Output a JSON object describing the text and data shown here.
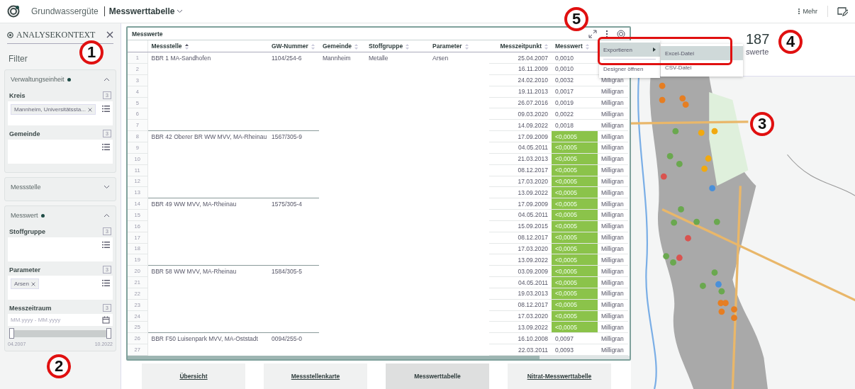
{
  "header": {
    "app_name": "Grundwassergüte",
    "view_title": "Messwerttabelle",
    "more_label": "Mehr"
  },
  "sidebar": {
    "title": "ANALYSEKONTEXT",
    "filter_heading": "Filter",
    "sections": [
      {
        "title": "Verwaltungseinheit",
        "active": true,
        "expanded": true,
        "fields": [
          {
            "kind": "chips",
            "label": "Kreis",
            "count": "3",
            "chips": [
              "Mannheim, Universitätssta..."
            ]
          },
          {
            "kind": "chips",
            "label": "Gemeinde",
            "count": "3"
          }
        ]
      },
      {
        "title": "Messstelle",
        "active": false,
        "expanded": false
      },
      {
        "title": "Messwert",
        "active": true,
        "expanded": true,
        "fields": [
          {
            "kind": "chips",
            "label": "Stoffgruppe",
            "count": "3"
          },
          {
            "kind": "chips",
            "label": "Parameter",
            "count": "3",
            "chips": [
              "Arsen"
            ]
          },
          {
            "kind": "daterange",
            "label": "Messzeitraum",
            "count": "3",
            "placeholder": "MM.yyyy - MM.yyyy",
            "range_start": "04.2007",
            "range_end": "10.2022",
            "level": 1
          }
        ]
      }
    ]
  },
  "table": {
    "title": "Messwerte",
    "columns": [
      {
        "label": "Messstelle",
        "sorted": true
      },
      {
        "label": "GW-Nummer",
        "sorted": false
      },
      {
        "label": "Gemeinde",
        "sorted": false
      },
      {
        "label": "Stoffgruppe",
        "sorted": false
      },
      {
        "label": "Parameter",
        "sorted": false
      },
      {
        "label": "Messzeitpunkt",
        "sorted": false
      },
      {
        "label": "Messwert",
        "sorted": false
      }
    ],
    "groups": [
      {
        "messstelle": "BBR 1 MA-Sandhofen",
        "gw_nummer": "1104/254-6",
        "gemeinde": "Mannheim",
        "stoffgruppe": "Metalle",
        "parameter": "Arsen",
        "rows": [
          {
            "nr": "1",
            "date": "25.04.2007",
            "value": "0,0010",
            "highlighted": false
          },
          {
            "nr": "2",
            "date": "16.11.2009",
            "value": "0,0010",
            "highlighted": false
          },
          {
            "nr": "3",
            "date": "24.02.2010",
            "value": "0,0032",
            "unit": "Milligran",
            "highlighted": false
          },
          {
            "nr": "4",
            "date": "19.11.2013",
            "value": "0,0017",
            "unit": "Milligran",
            "highlighted": false
          },
          {
            "nr": "5",
            "date": "26.07.2016",
            "value": "0,0019",
            "unit": "Milligran",
            "highlighted": false
          },
          {
            "nr": "6",
            "date": "09.03.2020",
            "value": "0,0022",
            "unit": "Milligran",
            "highlighted": false
          },
          {
            "nr": "7",
            "date": "14.09.2022",
            "value": "0,0018",
            "unit": "Milligran",
            "highlighted": false
          }
        ]
      },
      {
        "messstelle": "BBR 42 Oberer BR WW MVV, MA-Rheinau",
        "gw_nummer": "1567/305-9",
        "rows": [
          {
            "nr": "8",
            "date": "17.09.2009",
            "value": "<0,0005",
            "unit": "Milligran",
            "highlighted": true
          },
          {
            "nr": "9",
            "date": "04.05.2011",
            "value": "<0,0005",
            "unit": "Milligran",
            "highlighted": true
          },
          {
            "nr": "10",
            "date": "21.03.2013",
            "value": "<0,0005",
            "unit": "Milligran",
            "highlighted": true
          },
          {
            "nr": "11",
            "date": "08.12.2017",
            "value": "<0,0005",
            "unit": "Milligran",
            "highlighted": true
          },
          {
            "nr": "12",
            "date": "17.03.2020",
            "value": "<0,0005",
            "unit": "Milligran",
            "highlighted": true
          },
          {
            "nr": "13",
            "date": "13.09.2022",
            "value": "<0,0005",
            "unit": "Milligran",
            "highlighted": true
          }
        ]
      },
      {
        "messstelle": "BBR 49 WW MVV, MA-Rheinau",
        "gw_nummer": "1575/305-4",
        "rows": [
          {
            "nr": "14",
            "date": "17.09.2009",
            "value": "<0,0005",
            "unit": "Milligran",
            "highlighted": true
          },
          {
            "nr": "15",
            "date": "04.05.2011",
            "value": "<0,0005",
            "unit": "Milligran",
            "highlighted": true
          },
          {
            "nr": "16",
            "date": "15.09.2015",
            "value": "<0,0005",
            "unit": "Milligran",
            "highlighted": true
          },
          {
            "nr": "17",
            "date": "08.12.2017",
            "value": "<0,0005",
            "unit": "Milligran",
            "highlighted": true
          },
          {
            "nr": "18",
            "date": "17.03.2020",
            "value": "<0,0005",
            "unit": "Milligran",
            "highlighted": true
          },
          {
            "nr": "19",
            "date": "13.09.2022",
            "value": "<0,0005",
            "unit": "Milligran",
            "highlighted": true
          }
        ]
      },
      {
        "messstelle": "BBR 58 WW MVV, MA-Rheinau",
        "gw_nummer": "1584/305-5",
        "rows": [
          {
            "nr": "20",
            "date": "03.09.2009",
            "value": "<0,0005",
            "unit": "Milligran",
            "highlighted": true
          },
          {
            "nr": "21",
            "date": "04.05.2011",
            "value": "<0,0005",
            "unit": "Milligran",
            "highlighted": true
          },
          {
            "nr": "22",
            "date": "19.03.2013",
            "value": "<0,0005",
            "unit": "Milligran",
            "highlighted": true
          },
          {
            "nr": "23",
            "date": "08.12.2017",
            "value": "<0,0005",
            "unit": "Milligran",
            "highlighted": true
          },
          {
            "nr": "24",
            "date": "17.03.2020",
            "value": "<0,0005",
            "unit": "Milligran",
            "highlighted": true
          },
          {
            "nr": "25",
            "date": "13.09.2022",
            "value": "<0,0005",
            "unit": "Milligran",
            "highlighted": true
          }
        ]
      },
      {
        "messstelle": "BBR F50 Luisenpark MVV, MA-Oststadt",
        "gw_nummer": "0094/255-0",
        "rows": [
          {
            "nr": "26",
            "date": "16.10.2008",
            "value": "0,0097",
            "unit": "Milligran",
            "highlighted": false
          },
          {
            "nr": "27",
            "date": "22.03.2011",
            "value": "0,0093",
            "unit": "Milligran",
            "highlighted": false
          }
        ]
      }
    ]
  },
  "menu": {
    "items": [
      {
        "label": "Exportieren",
        "selected": true,
        "submenu": [
          {
            "label": "Excel-Datei",
            "selected": true
          },
          {
            "label": "CSV-Datei",
            "selected": false
          }
        ]
      },
      {
        "label": "Designer öffnen",
        "selected": false
      }
    ]
  },
  "kpi": {
    "value": "187",
    "label": "swerte"
  },
  "nav_tabs": [
    {
      "label": "Übersicht",
      "selected": false
    },
    {
      "label": "Messstellenkarte",
      "selected": false
    },
    {
      "label": "Messwerttabelle",
      "selected": true
    },
    {
      "label": "Nitrat-Messwerttabelle",
      "selected": false
    }
  ],
  "callouts": [
    {
      "number": "1"
    },
    {
      "number": "2"
    },
    {
      "number": "3"
    },
    {
      "number": "4"
    },
    {
      "number": "5"
    }
  ]
}
